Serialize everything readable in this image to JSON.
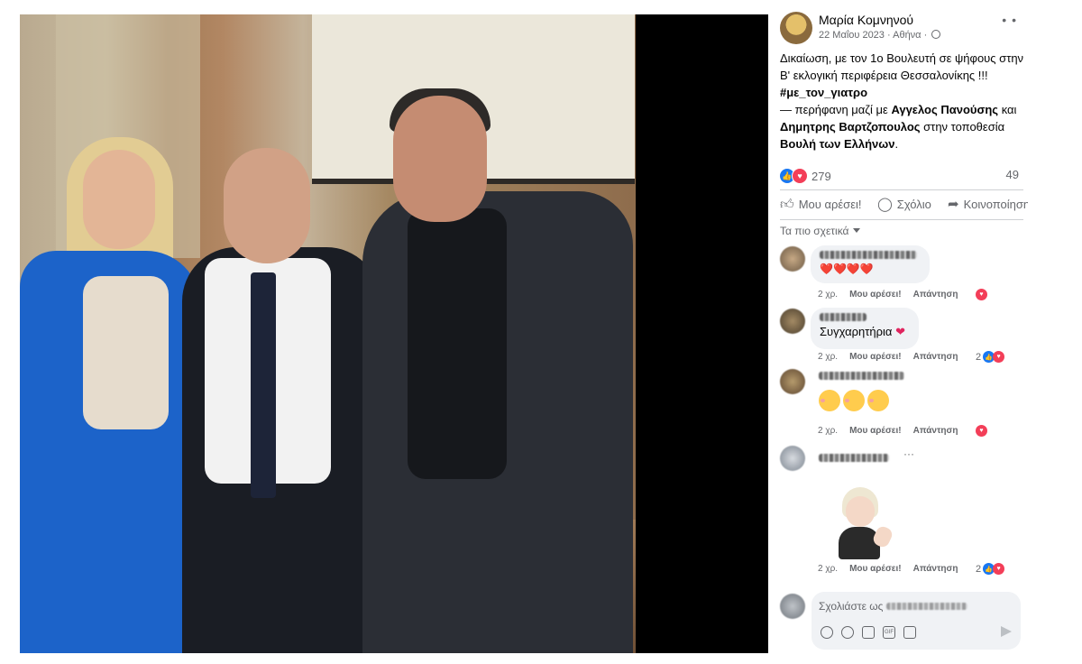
{
  "post": {
    "author": "Μαρία Κομνηνού",
    "date": "22 Μαΐου 2023",
    "location": "Αθήνα",
    "caption_line1": "Δικαίωση, με τον 1ο Βουλευτή σε ψήφους στην",
    "caption_line2": "Β' εκλογική περιφέρεια Θεσσαλονίκης !!!",
    "hashtag": "#με_τον_γιατρο",
    "tag_prefix": "— περήφανη μαζί με ",
    "tag_person1": "Αγγελος Πανούσης",
    "tag_and": " και",
    "tag_person2": "Δημητρης Βαρτζοπουλος",
    "tag_location_prefix": " στην τοποθεσία",
    "tag_location": "Βουλή των Ελλήνων",
    "reaction_count": "279",
    "comment_count": "49"
  },
  "actions": {
    "like": "Μου αρέσει!",
    "comment": "Σχόλιο",
    "share": "Κοινοποίηση"
  },
  "sort_label": "Τα πιο σχετικά",
  "comments": [
    {
      "text": "",
      "emoji": "❤️❤️❤️❤️",
      "time": "2 χρ.",
      "like": "Μου αρέσει!",
      "reply": "Απάντηση",
      "reaction_count": ""
    },
    {
      "text": "Συγχαρητήρια",
      "time": "2 χρ.",
      "like": "Μου αρέσει!",
      "reply": "Απάντηση",
      "reaction_count": "2"
    },
    {
      "text": "",
      "time": "2 χρ.",
      "like": "Μου αρέσει!",
      "reply": "Απάντηση",
      "reaction_count": ""
    },
    {
      "text": "",
      "time": "2 χρ.",
      "like": "Μου αρέσει!",
      "reply": "Απάντηση",
      "reaction_count": "2"
    }
  ],
  "composer": {
    "placeholder": "Σχολιάστε ως"
  },
  "icons": {
    "globe": "globe-icon",
    "more": "more-icon",
    "like": "like-icon",
    "comment": "comment-icon",
    "share": "share-icon",
    "send": "send-icon"
  },
  "colors": {
    "facebook_blue": "#1877f2",
    "love_red": "#f33e58",
    "meta_gray": "#65676b"
  }
}
